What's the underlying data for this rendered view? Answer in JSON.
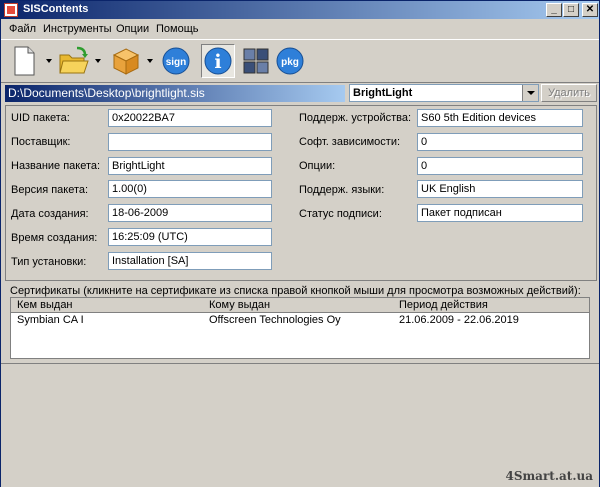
{
  "window": {
    "title": "SISContents"
  },
  "menu": [
    "Файл",
    "Инструменты",
    "Опции",
    "Помощь"
  ],
  "toolbar": {
    "icons": [
      "new-file-icon",
      "open-folder-icon",
      "package-box-icon",
      "sign-icon",
      "info-icon",
      "contents-icon",
      "pkg-icon"
    ],
    "sign_text": "sign",
    "info_text": "i",
    "pkg_text": "pkg"
  },
  "path": "D:\\Documents\\Desktop\\brightlight.sis",
  "package_select": "BrightLight",
  "delete_button": "Удалить",
  "left_fields": [
    {
      "label": "UID пакета:",
      "value": "0x20022BA7"
    },
    {
      "label": "Поставщик:",
      "value": ""
    },
    {
      "label": "Название пакета:",
      "value": "BrightLight"
    },
    {
      "label": "Версия пакета:",
      "value": "1.00(0)"
    },
    {
      "label": "Дата создания:",
      "value": "18-06-2009"
    },
    {
      "label": "Время создания:",
      "value": "16:25:09 (UTC)"
    },
    {
      "label": "Тип установки:",
      "value": "Installation [SA]"
    }
  ],
  "right_fields": [
    {
      "label": "Поддерж. устройства:",
      "value": "S60 5th Edition devices"
    },
    {
      "label": "Софт. зависимости:",
      "value": "0"
    },
    {
      "label": "Опции:",
      "value": "0"
    },
    {
      "label": "Поддерж. языки:",
      "value": "UK English"
    },
    {
      "label": "Статус подписи:",
      "value": "Пакет подписан"
    }
  ],
  "certificates": {
    "caption": "Сертификаты (кликните на сертификате из списка правой кнопкой мыши для просмотра возможных действий):",
    "columns": [
      "Кем выдан",
      "Кому выдан",
      "Период действия"
    ],
    "rows": [
      [
        "Symbian CA I",
        "Offscreen Technologies Oy",
        "21.06.2009 - 22.06.2019"
      ]
    ]
  },
  "watermark": "4Smart.at.ua",
  "colors": {
    "titlebar": "#0a246a",
    "accent": "#2e7fd9",
    "face": "#d4d0c8"
  }
}
